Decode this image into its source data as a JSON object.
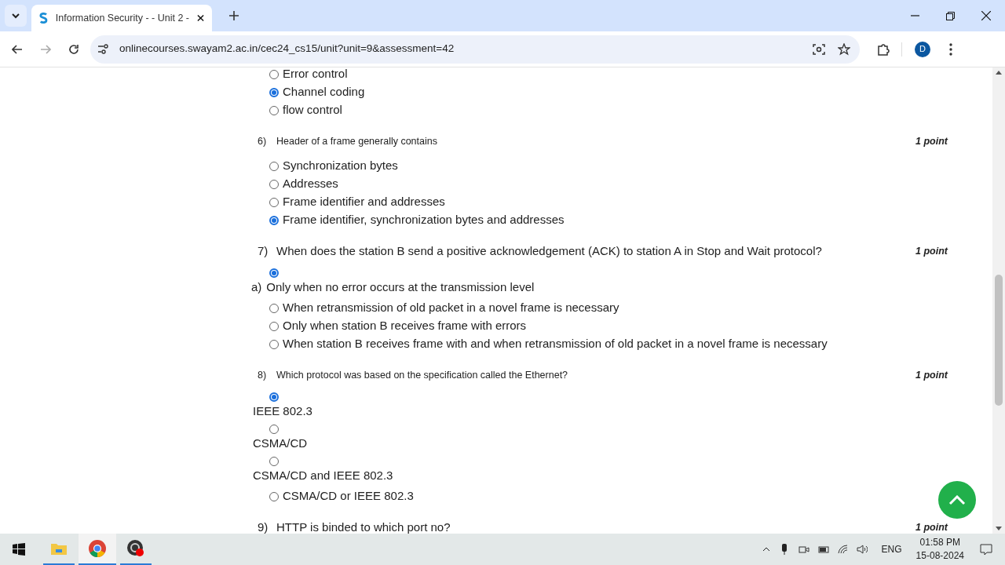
{
  "browser": {
    "tab_title": "Information Security - - Unit 2 -",
    "url": "onlinecourses.swayam2.ac.in/cec24_cs15/unit?unit=9&assessment=42",
    "profile_initial": "D"
  },
  "questions": [
    {
      "options": [
        {
          "kind": "inline",
          "text": "Error control",
          "selected": false
        },
        {
          "kind": "inline",
          "text": "Channel coding",
          "selected": true
        },
        {
          "kind": "inline",
          "text": "flow control",
          "selected": false
        }
      ]
    },
    {
      "number": "6)",
      "text": "Header of a frame generally contains",
      "kind": "small",
      "points": "1 point",
      "options": [
        {
          "kind": "inline",
          "text": "Synchronization bytes",
          "selected": false
        },
        {
          "kind": "inline",
          "text": "Addresses",
          "selected": false
        },
        {
          "kind": "inline",
          "text": "Frame identifier and addresses",
          "selected": false
        },
        {
          "kind": "inline",
          "text": "Frame identifier, synchronization bytes and addresses",
          "selected": true
        }
      ]
    },
    {
      "number": "7)",
      "text": "When does the station B send a positive acknowledgement (ACK) to station A in Stop and Wait protocol?",
      "kind": "large",
      "points": "1 point",
      "options": [
        {
          "kind": "stacked",
          "prefix": "a)",
          "text": "Only when no error occurs at the transmission level",
          "selected": true
        },
        {
          "kind": "inline",
          "text": "When retransmission of old packet in a novel frame is necessary",
          "selected": false
        },
        {
          "kind": "inline",
          "text": "Only when station B receives frame with errors",
          "selected": false
        },
        {
          "kind": "inline",
          "text": "When station B receives frame with and when retransmission of old packet in a novel frame is necessary",
          "selected": false
        }
      ]
    },
    {
      "number": "8)",
      "text": "Which protocol was based on the specification called the Ethernet?",
      "kind": "small",
      "points": "1 point",
      "options": [
        {
          "kind": "stacked",
          "text": "IEEE 802.3",
          "selected": true
        },
        {
          "kind": "stacked",
          "text": "CSMA/CD",
          "selected": false
        },
        {
          "kind": "stacked",
          "text": "CSMA/CD and IEEE 802.3",
          "selected": false
        },
        {
          "kind": "inline",
          "text": "CSMA/CD or IEEE 802.3",
          "selected": false
        }
      ]
    },
    {
      "number": "9)",
      "text": "HTTP is binded to which port no?",
      "kind": "large",
      "points": "1 point"
    }
  ],
  "taskbar": {
    "language": "ENG",
    "time": "01:58 PM",
    "date": "15-08-2024"
  }
}
